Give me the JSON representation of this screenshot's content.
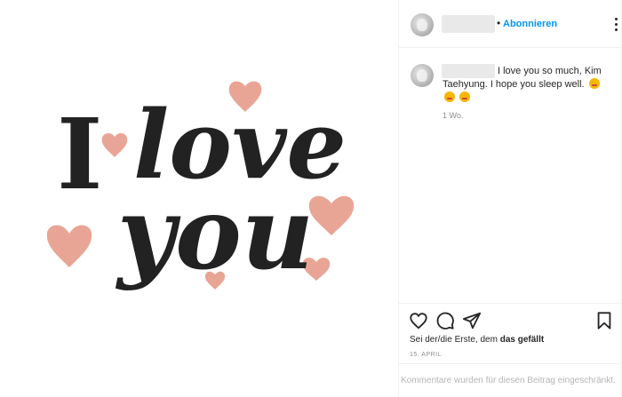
{
  "post": {
    "image": {
      "line1": "I",
      "line1b": "love",
      "line2": "you",
      "heart_color": "#e8a595",
      "text_color": "#222222"
    },
    "header": {
      "follow_label": "Abonnieren",
      "separator": "•"
    },
    "caption": {
      "text": "I love you so much, Kim Taehyung. I hope you sleep well.",
      "time_ago": "1 Wo."
    },
    "actions": {
      "likes_prefix": "Sei der/die Erste, dem ",
      "likes_bold": "das gefällt",
      "date": "15. APRIL"
    },
    "footer": {
      "restricted_text": "Kommentare wurden für diesen Beitrag eingeschränkt."
    },
    "colors": {
      "accent": "#0095f6",
      "muted": "#8e8e8e",
      "border": "#efefef"
    }
  }
}
